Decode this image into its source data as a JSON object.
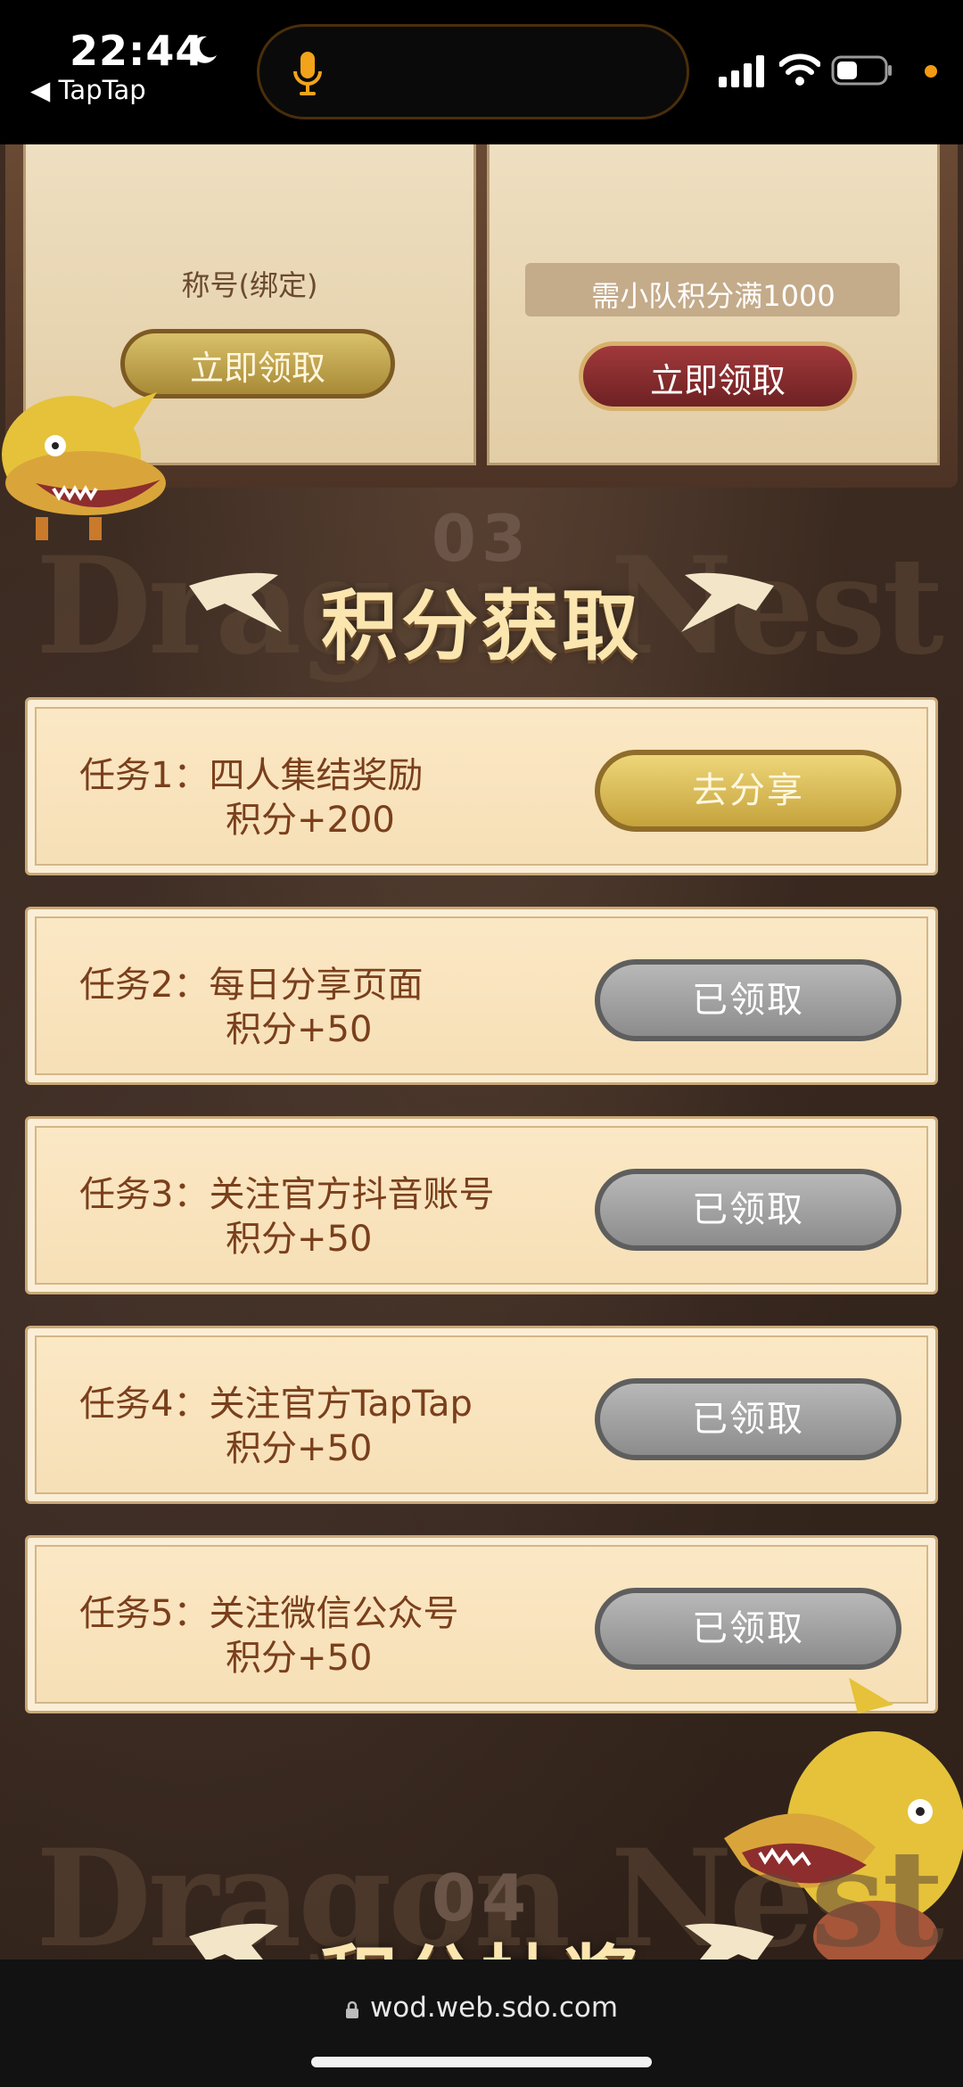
{
  "status_bar": {
    "time": "22:44",
    "back_app": "◀ TapTap"
  },
  "rewards": {
    "left_caption": "称号(绑定)",
    "left_button": "立即领取",
    "right_caption": "需小队积分满1000",
    "right_button": "立即领取"
  },
  "section3": {
    "number": "03",
    "title": "积分获取",
    "watermark": "Dragon Nest"
  },
  "tasks": [
    {
      "title": "任务1：四人集结奖励",
      "points": "积分+200",
      "button": "去分享",
      "state": "active"
    },
    {
      "title": "任务2：每日分享页面",
      "points": "积分+50",
      "button": "已领取",
      "state": "claimed"
    },
    {
      "title": "任务3：关注官方抖音账号",
      "points": "积分+50",
      "button": "已领取",
      "state": "claimed"
    },
    {
      "title": "任务4：关注官方TapTap",
      "points": "积分+50",
      "button": "已领取",
      "state": "claimed"
    },
    {
      "title": "任务5：关注微信公众号",
      "points": "积分+50",
      "button": "已领取",
      "state": "claimed"
    }
  ],
  "section4": {
    "number": "04",
    "title": "积分抽奖"
  },
  "browser": {
    "url": "wod.web.sdo.com"
  },
  "colors": {
    "page_bg": "#34241c",
    "task_text": "#7a3f1c",
    "gold_button": "#c5a33c",
    "claimed_button": "#8c8c8c",
    "red_button": "#8f2c2e"
  }
}
